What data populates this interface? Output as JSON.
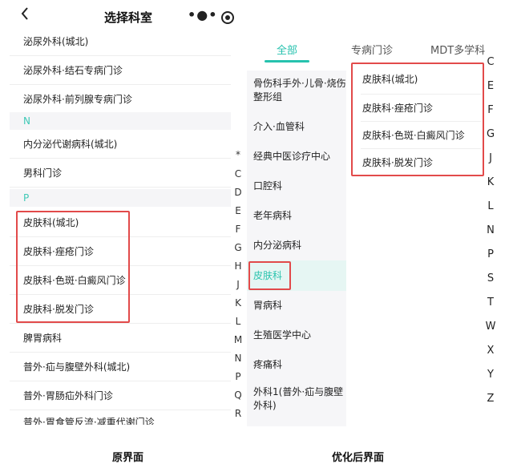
{
  "original": {
    "title": "选择科室",
    "back_icon": "chevron-left-icon",
    "more_icon": "more-dots-icon",
    "close_icon": "target-icon",
    "rows_top": [
      "泌尿外科(城北)",
      "泌尿外科·结石专病门诊",
      "泌尿外科·前列腺专病门诊"
    ],
    "section_n": "N",
    "rows_n": [
      "内分泌代谢病科(城北)",
      "男科门诊"
    ],
    "section_p": "P",
    "rows_p": [
      "皮肤科(城北)",
      "皮肤科·痤疮门诊",
      "皮肤科·色斑·白癜风门诊",
      "皮肤科·脱发门诊",
      "脾胃病科",
      "普外·疝与腹壁外科(城北)",
      "普外·胃肠疝外科门诊",
      "普外·胃食管反流·减重代谢门诊"
    ],
    "index": [
      "*",
      "C",
      "D",
      "E",
      "F",
      "G",
      "H",
      "J",
      "K",
      "L",
      "M",
      "N",
      "P",
      "Q",
      "R"
    ],
    "caption": "原界面",
    "highlight_color": "#e24a4a"
  },
  "optimized": {
    "tabs": [
      "全部",
      "专病门诊",
      "MDT多学科"
    ],
    "active_tab": "全部",
    "side_items": [
      "骨伤科手外·儿骨·烧伤整形组",
      "介入·血管科",
      "经典中医诊疗中心",
      "口腔科",
      "老年病科",
      "内分泌病科",
      "皮肤科",
      "胃病科",
      "生殖医学中心",
      "疼痛科",
      "外科1(普外·疝与腹壁外科)"
    ],
    "active_side": "皮肤科",
    "list": [
      "皮肤科(城北)",
      "皮肤科·痤疮门诊",
      "皮肤科·色斑·白癜风门诊",
      "皮肤科·脱发门诊"
    ],
    "index": [
      "C",
      "E",
      "F",
      "G",
      "J",
      "K",
      "L",
      "N",
      "P",
      "S",
      "T",
      "W",
      "X",
      "Y",
      "Z"
    ],
    "caption": "优化后界面",
    "accent_color": "#26c2ae"
  }
}
